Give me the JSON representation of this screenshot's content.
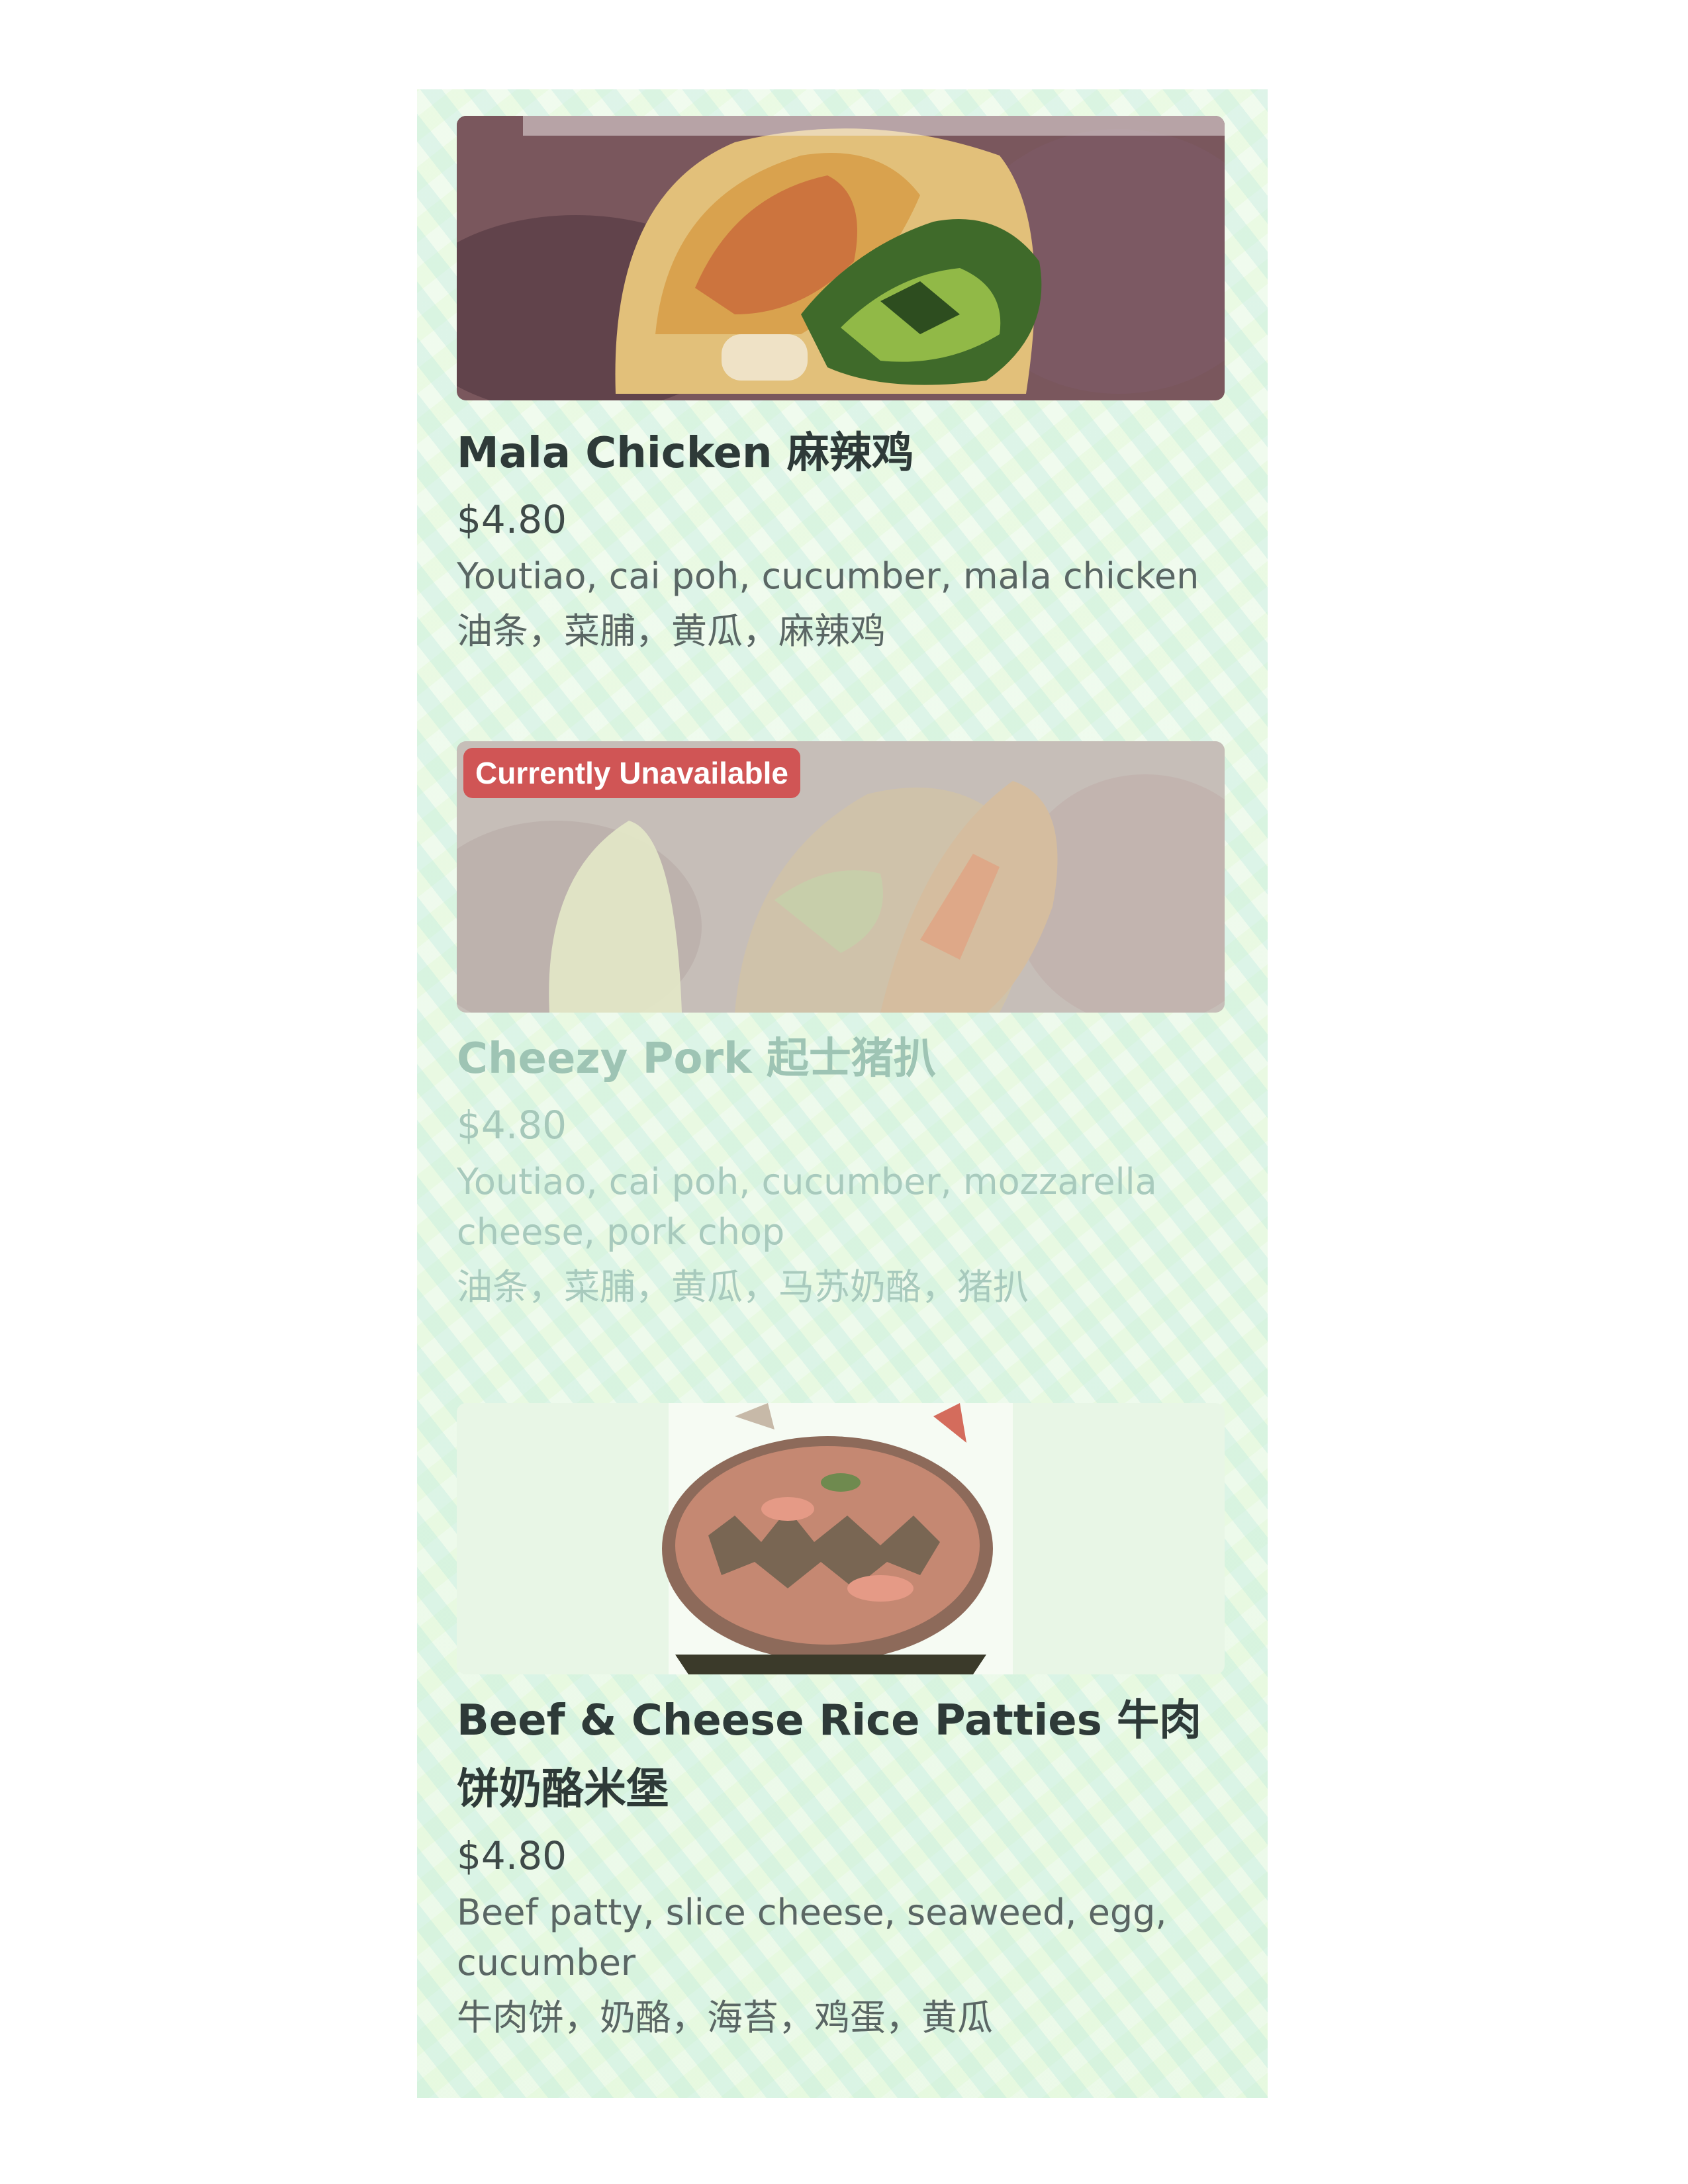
{
  "menu": {
    "items": [
      {
        "title": "Mala Chicken 麻辣鸡",
        "price": "$4.80",
        "description": "Youtiao, cai poh, cucumber, mala chicken",
        "description_cn": "油条，菜脯，黄瓜，麻辣鸡"
      },
      {
        "title": "Cheezy Pork 起士猪扒",
        "price": "$4.80",
        "badge": "Currently Unavailable",
        "description": "Youtiao, cai poh, cucumber, mozzarella cheese, pork chop",
        "description_cn": "油条，菜脯，黄瓜，马苏奶酪，猪扒"
      },
      {
        "title": "Beef & Cheese Rice Patties 牛肉饼奶酪米堡",
        "price": "$4.80",
        "description": "Beef patty, slice cheese, seaweed, egg, cucumber",
        "description_cn": "牛肉饼，奶酪，海苔，鸡蛋，黄瓜"
      }
    ]
  },
  "colors": {
    "badge_bg": "#d05555",
    "title_text": "#2e3a38",
    "unavailable_text": "#9ec4b4"
  }
}
